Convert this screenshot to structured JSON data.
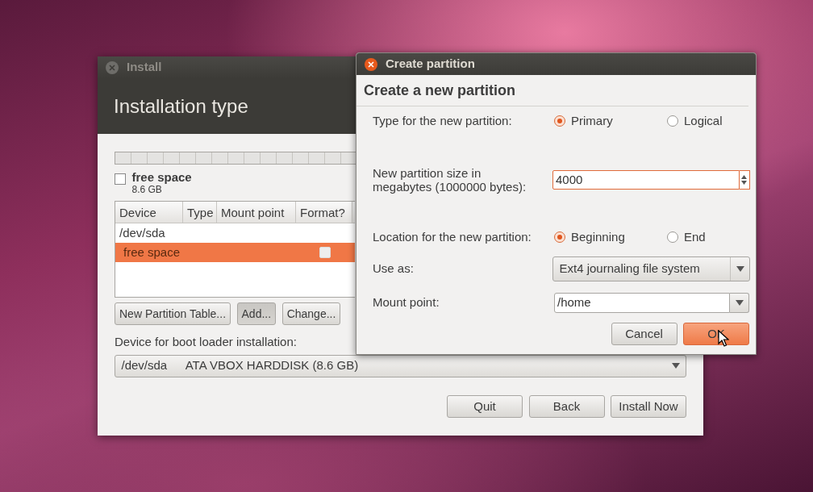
{
  "install_window": {
    "title": "Install",
    "heading": "Installation type",
    "legend": [
      {
        "label": "free space",
        "size": "8.6 GB",
        "checked": false
      }
    ],
    "table": {
      "columns": [
        "Device",
        "Type",
        "Mount point",
        "Format?"
      ],
      "rows": [
        {
          "device": "/dev/sda",
          "selected": false
        },
        {
          "device": "free space",
          "format": false,
          "selected": true
        }
      ]
    },
    "table_buttons": [
      {
        "label": "New Partition Table...",
        "pressed": false
      },
      {
        "label": "Add...",
        "pressed": true
      },
      {
        "label": "Change...",
        "pressed": false
      }
    ],
    "boot_loader": {
      "label": "Device for boot loader installation:",
      "device": "/dev/sda",
      "description": "ATA VBOX HARDDISK (8.6 GB)"
    },
    "buttons": [
      "Quit",
      "Back",
      "Install Now"
    ]
  },
  "dialog": {
    "title": "Create partition",
    "heading": "Create a new partition",
    "type": {
      "label": "Type for the new partition:",
      "options": [
        {
          "label": "Primary",
          "selected": true
        },
        {
          "label": "Logical",
          "selected": false
        }
      ]
    },
    "size": {
      "label": "New partition size in megabytes (1000000 bytes):",
      "value": "4000"
    },
    "location": {
      "label": "Location for the new partition:",
      "options": [
        {
          "label": "Beginning",
          "selected": true
        },
        {
          "label": "End",
          "selected": false
        }
      ]
    },
    "use_as": {
      "label": "Use as:",
      "value": "Ext4 journaling file system"
    },
    "mount_point": {
      "label": "Mount point:",
      "value": "/home"
    },
    "buttons": [
      {
        "label": "Cancel",
        "kind": "normal"
      },
      {
        "label": "OK",
        "kind": "default"
      }
    ]
  }
}
